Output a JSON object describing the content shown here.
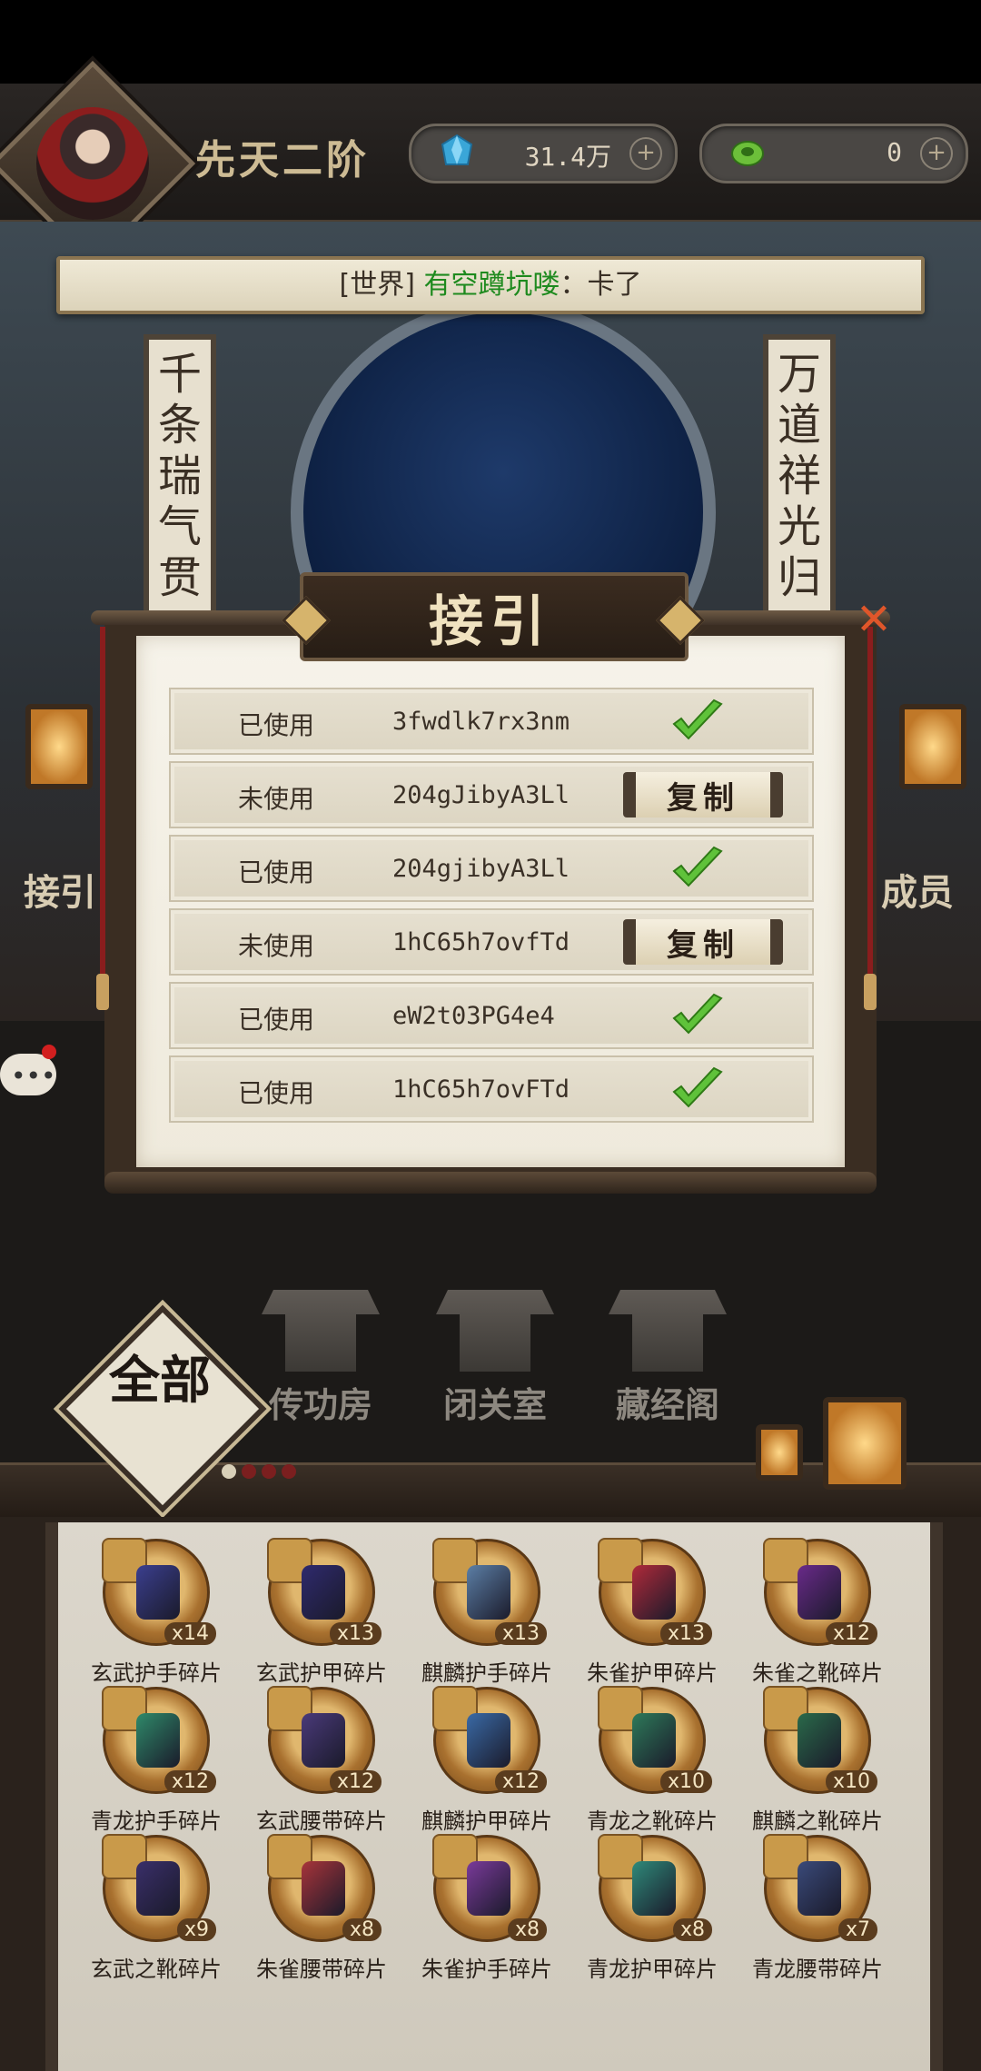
{
  "header": {
    "rank": "先天二阶",
    "currency1": {
      "icon": "jade-icon",
      "value": "31.4万",
      "plus": "+"
    },
    "currency2": {
      "icon": "spirit-stone-icon",
      "value": "0",
      "plus": "+"
    }
  },
  "world_chat": {
    "channel": "[世界]",
    "player": "有空蹲坑喽",
    "message": "：卡了"
  },
  "scene": {
    "couplet_left": "千条瑞气贯",
    "couplet_right": "万道祥光归",
    "side_left": "接引",
    "side_right": "成员"
  },
  "dialog": {
    "title": "接引",
    "close": "✕",
    "copy_label": "复制",
    "codes": [
      {
        "status": "已使用",
        "code": "3fwdlk7rx3nm",
        "used": true
      },
      {
        "status": "未使用",
        "code": "204gJibyA3Ll",
        "used": false
      },
      {
        "status": "已使用",
        "code": "204gjibyA3Ll",
        "used": true
      },
      {
        "status": "未使用",
        "code": "1hC65h7ovfTd",
        "used": false
      },
      {
        "status": "已使用",
        "code": "eW2t03PG4e4",
        "used": true
      },
      {
        "status": "已使用",
        "code": "1hC65h7ovFTd",
        "used": true
      }
    ]
  },
  "buildings": {
    "all": "全部",
    "items": [
      "传功房",
      "闭关室",
      "藏经阁"
    ]
  },
  "inventory": [
    {
      "name": "玄武护手碎片",
      "count": "x14",
      "color": "#3b3f8f"
    },
    {
      "name": "玄武护甲碎片",
      "count": "x13",
      "color": "#2f2a6e"
    },
    {
      "name": "麒麟护手碎片",
      "count": "x13",
      "color": "#5c7fa6"
    },
    {
      "name": "朱雀护甲碎片",
      "count": "x13",
      "color": "#b02a3a"
    },
    {
      "name": "朱雀之靴碎片",
      "count": "x12",
      "color": "#6a2a8a"
    },
    {
      "name": "青龙护手碎片",
      "count": "x12",
      "color": "#2f8a6a"
    },
    {
      "name": "玄武腰带碎片",
      "count": "x12",
      "color": "#4a3a7a"
    },
    {
      "name": "麒麟护甲碎片",
      "count": "x12",
      "color": "#3a6aa6"
    },
    {
      "name": "青龙之靴碎片",
      "count": "x10",
      "color": "#2e7a5a"
    },
    {
      "name": "麒麟之靴碎片",
      "count": "x10",
      "color": "#2a6a4a"
    },
    {
      "name": "玄武之靴碎片",
      "count": "x9",
      "color": "#3a2f6a"
    },
    {
      "name": "朱雀腰带碎片",
      "count": "x8",
      "color": "#a8343a"
    },
    {
      "name": "朱雀护手碎片",
      "count": "x8",
      "color": "#7a3a9a"
    },
    {
      "name": "青龙护甲碎片",
      "count": "x8",
      "color": "#2f8a7a"
    },
    {
      "name": "青龙腰带碎片",
      "count": "x7",
      "color": "#3a4a7a"
    }
  ]
}
